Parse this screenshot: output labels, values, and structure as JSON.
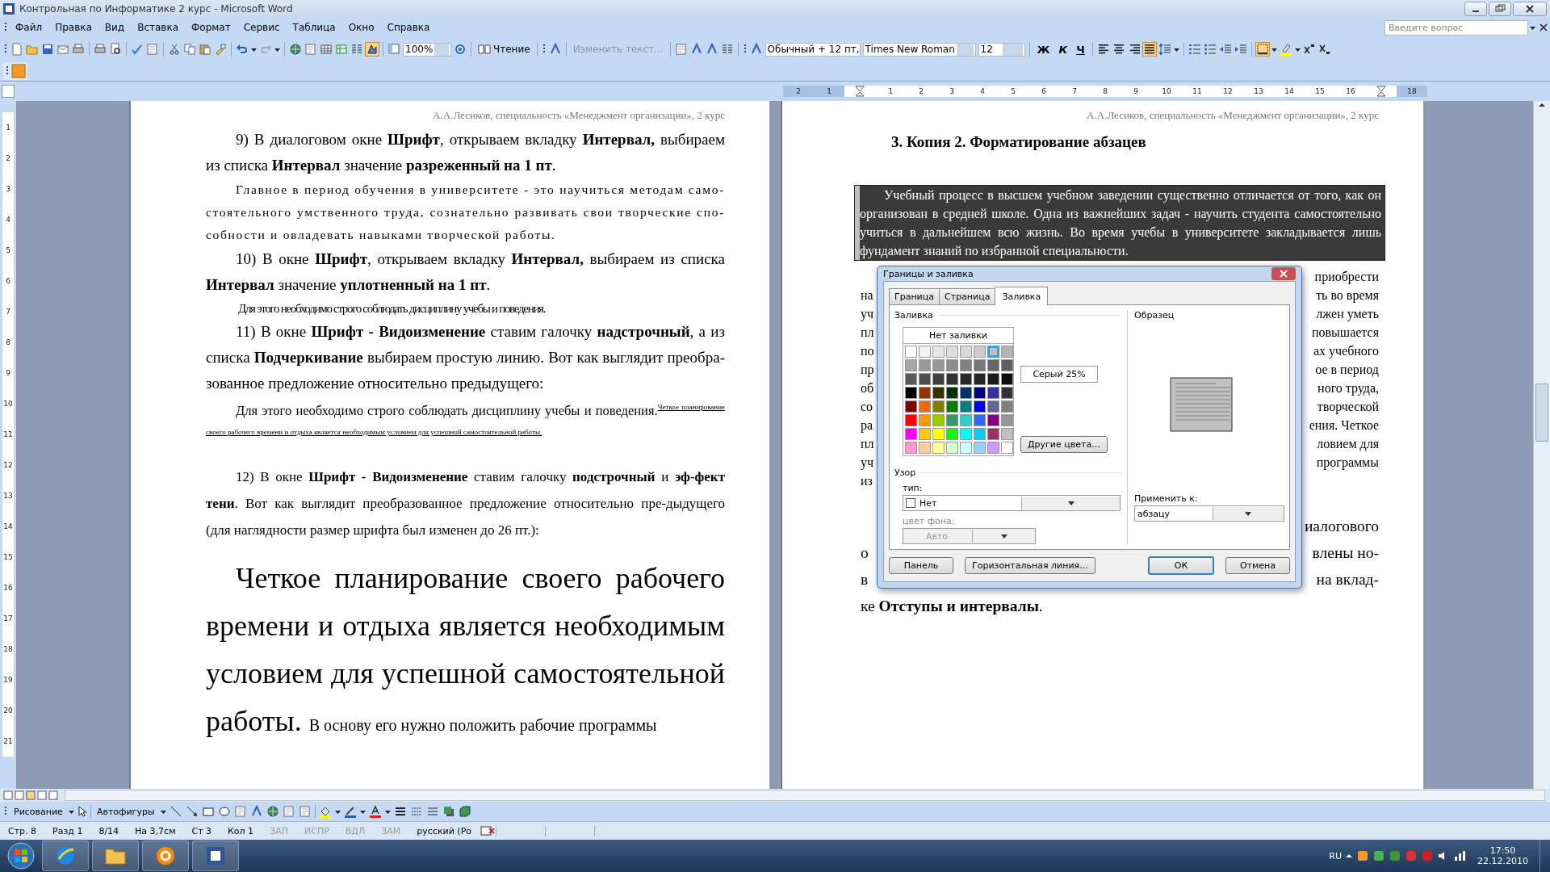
{
  "window": {
    "title": "Контрольная по Информатике  2 курс - Microsoft Word"
  },
  "menu": [
    {
      "label": "Файл"
    },
    {
      "label": "Правка"
    },
    {
      "label": "Вид"
    },
    {
      "label": "Вставка"
    },
    {
      "label": "Формат"
    },
    {
      "label": "Сервис"
    },
    {
      "label": "Таблица"
    },
    {
      "label": "Окно"
    },
    {
      "label": "Справка"
    }
  ],
  "help_field": {
    "placeholder": "Введите вопрос"
  },
  "standard_toolbar": {
    "zoom": "100%",
    "reading_button": "Чтение",
    "edit_text_button": "Изменить текст..."
  },
  "formatting_toolbar": {
    "style": "Обычный + 12 пт,",
    "font": "Times New Roman",
    "size": "12",
    "bold": "Ж",
    "italic": "К",
    "underline": "Ч",
    "alignments": [
      {
        "kind": "left",
        "selected": false
      },
      {
        "kind": "center",
        "selected": false
      },
      {
        "kind": "right",
        "selected": false
      },
      {
        "kind": "justify",
        "selected": true
      }
    ]
  },
  "horizontal_ruler": [
    {
      "label": "2",
      "margin": true
    },
    {
      "label": "1",
      "margin": true
    },
    {
      "label": "1",
      "margin": false
    },
    {
      "label": "2",
      "margin": false
    },
    {
      "label": "3",
      "margin": false
    },
    {
      "label": "4",
      "margin": false
    },
    {
      "label": "5",
      "margin": false
    },
    {
      "label": "6",
      "margin": false
    },
    {
      "label": "7",
      "margin": false
    },
    {
      "label": "8",
      "margin": false
    },
    {
      "label": "9",
      "margin": false
    },
    {
      "label": "10",
      "margin": false
    },
    {
      "label": "11",
      "margin": false
    },
    {
      "label": "12",
      "margin": false
    },
    {
      "label": "13",
      "margin": false
    },
    {
      "label": "14",
      "margin": false
    },
    {
      "label": "15",
      "margin": false
    },
    {
      "label": "16",
      "margin": false
    },
    {
      "label": "18",
      "margin": true
    }
  ],
  "vertical_ruler": [
    "1",
    "2",
    "3",
    "4",
    "5",
    "6",
    "7",
    "8",
    "9",
    "10",
    "11",
    "12",
    "13",
    "14",
    "15",
    "16",
    "17",
    "18",
    "19",
    "20",
    "21"
  ],
  "left_page": {
    "header": "А.А.Лесиков, специальность «Менеджмент организации», 2 курс",
    "paragraphs": [
      {
        "kind": "normal",
        "text": "9) В диалоговом окне **Шрифт**, открываем вкладку **Интервал,** выбираем из списка **Интервал** значение **разреженный на 1 пт**."
      },
      {
        "kind": "expanded",
        "text": "Главное в период обучения в университете - это научиться методам само-стоятельного умственного труда, сознательно развивать свои творческие спо-собности и овладевать навыками творческой работы."
      },
      {
        "kind": "normal",
        "text": "10) В  окне **Шрифт**, открываем вкладку **Интервал,** выбираем из списка **Интервал** значение **уплотненный на 1 пт**."
      },
      {
        "kind": "condensed",
        "text": "Для этого необходимо строго соблюдать дисциплину учебы и поведения."
      },
      {
        "kind": "normal",
        "text": "11) В окне  **Шрифт - Видоизменение** ставим галочку **надстрочный**, а из списка **Подчеркивание** выбираем простую линию. Вот как выглядит преобра-зованное предложение относительно предыдущего:"
      },
      {
        "kind": "superscript",
        "text": "Для этого необходимо строго соблюдать дисциплину учебы и поведения.$^{Четкое планирование своего рабочего времени и отдыха является необходимым условием для успешной самостоятельной работы.}$"
      },
      {
        "kind": "small",
        "text": "12)  В окне  **Шрифт - Видоизменение** ставим галочку **подстрочный** и **эф-фект тени**. Вот как выглядит преобразованное предложение относительно пре-дыдущего (для наглядности размер шрифта был изменен до 26 пт.):"
      },
      {
        "kind": "large",
        "text": "Четкое планирование своего рабочего времени и отдыха является необходимым условием для успешной самостоятельной работы.",
        "continuation": "В основу его нужно положить рабочие программы"
      }
    ]
  },
  "right_page": {
    "header": "А.А.Лесиков, специальность «Менеджмент организации», 2 курс",
    "heading": "3. Копия 2. Форматирование абзацев",
    "shaded_paragraph": "Учебный процесс в высшем учебном заведении существенно отличается от того, как он организован в средней школе. Одна из важнейших задач - научить студента самостоятельно учиться в дальнейшем всю жизнь. Во время учебы в университете закладывается лишь фундамент знаний по избранной специальности.",
    "partial_lines": [
      {
        "right": "приобрести"
      },
      {
        "left": "на",
        "right": "ть во время"
      },
      {
        "left": "уч",
        "right": "лжен уметь"
      },
      {
        "left": "пл",
        "right": "повышается"
      },
      {
        "left": "по",
        "right": "ах учебного"
      },
      {
        "left": "пр",
        "right": "ое в период"
      },
      {
        "left": "об",
        "right": "ного труда,"
      },
      {
        "left": "со",
        "right": "творческой"
      },
      {
        "left": "ра",
        "right": "ения. Четкое"
      },
      {
        "left": "пл",
        "right": "ловием для"
      },
      {
        "left": "уч",
        "right": "программы"
      },
      {
        "left": "из"
      }
    ],
    "partial_lines_large": [
      {
        "right": "иалогового"
      },
      {
        "left": "о",
        "right": "влены но-"
      },
      {
        "left": "в",
        "right": "на вклад-"
      }
    ],
    "closing": "ке **Отступы и интервалы**."
  },
  "dialog": {
    "title": "Границы и заливка",
    "tabs": [
      {
        "label": "Граница",
        "selected": false
      },
      {
        "label": "Страница",
        "selected": false
      },
      {
        "label": "Заливка",
        "selected": true
      }
    ],
    "fill_group": "Заливка",
    "no_fill_button": "Нет заливки",
    "colors": [
      {
        "color": "#ffffff",
        "selected": false
      },
      {
        "color": "#f2f2f2",
        "selected": false
      },
      {
        "color": "#e6e6e6",
        "selected": false
      },
      {
        "color": "#dddddd",
        "selected": false
      },
      {
        "color": "#d9d9d9",
        "selected": false
      },
      {
        "color": "#cccccc",
        "selected": false
      },
      {
        "color": "#c0c0c0",
        "selected": true
      },
      {
        "color": "#b2b2b2",
        "selected": false
      },
      {
        "color": "#a6a6a6",
        "selected": false
      },
      {
        "color": "#999999",
        "selected": false
      },
      {
        "color": "#969696",
        "selected": false
      },
      {
        "color": "#8c8c8c",
        "selected": false
      },
      {
        "color": "#808080",
        "selected": false
      },
      {
        "color": "#777777",
        "selected": false
      },
      {
        "color": "#666666",
        "selected": false
      },
      {
        "color": "#5f5f5f",
        "selected": false
      },
      {
        "color": "#595959",
        "selected": false
      },
      {
        "color": "#4d4d4d",
        "selected": false
      },
      {
        "color": "#404040",
        "selected": false
      },
      {
        "color": "#333333",
        "selected": false
      },
      {
        "color": "#292929",
        "selected": false
      },
      {
        "color": "#262626",
        "selected": false
      },
      {
        "color": "#1c1c1c",
        "selected": false
      },
      {
        "color": "#0d0d0d",
        "selected": false
      },
      {
        "color": "#000000",
        "selected": false
      },
      {
        "color": "#993300",
        "selected": false
      },
      {
        "color": "#333300",
        "selected": false
      },
      {
        "color": "#003300",
        "selected": false
      },
      {
        "color": "#003366",
        "selected": false
      },
      {
        "color": "#000080",
        "selected": false
      },
      {
        "color": "#333399",
        "selected": false
      },
      {
        "color": "#333333",
        "selected": false
      },
      {
        "color": "#800000",
        "selected": false
      },
      {
        "color": "#ff6600",
        "selected": false
      },
      {
        "color": "#808000",
        "selected": false
      },
      {
        "color": "#008000",
        "selected": false
      },
      {
        "color": "#008080",
        "selected": false
      },
      {
        "color": "#0000ff",
        "selected": false
      },
      {
        "color": "#666699",
        "selected": false
      },
      {
        "color": "#808080",
        "selected": false
      },
      {
        "color": "#ff0000",
        "selected": false
      },
      {
        "color": "#ff9900",
        "selected": false
      },
      {
        "color": "#99cc00",
        "selected": false
      },
      {
        "color": "#339966",
        "selected": false
      },
      {
        "color": "#33cccc",
        "selected": false
      },
      {
        "color": "#3366ff",
        "selected": false
      },
      {
        "color": "#800080",
        "selected": false
      },
      {
        "color": "#969696",
        "selected": false
      },
      {
        "color": "#ff00ff",
        "selected": false
      },
      {
        "color": "#ffcc00",
        "selected": false
      },
      {
        "color": "#ffff00",
        "selected": false
      },
      {
        "color": "#00ff00",
        "selected": false
      },
      {
        "color": "#00ffff",
        "selected": false
      },
      {
        "color": "#00ccff",
        "selected": false
      },
      {
        "color": "#993366",
        "selected": false
      },
      {
        "color": "#c0c0c0",
        "selected": false
      },
      {
        "color": "#ff99cc",
        "selected": false
      },
      {
        "color": "#ffcc99",
        "selected": false
      },
      {
        "color": "#ffff99",
        "selected": false
      },
      {
        "color": "#ccffcc",
        "selected": false
      },
      {
        "color": "#ccffff",
        "selected": false
      },
      {
        "color": "#99ccff",
        "selected": false
      },
      {
        "color": "#cc99ff",
        "selected": false
      },
      {
        "color": "#ffffff",
        "selected": false
      }
    ],
    "color_name": "Серый 25%",
    "more_colors_button": "Другие цвета...",
    "pattern_group": "Узор",
    "style_label": "тип:",
    "style_value": "Нет",
    "background_label": "цвет фона:",
    "background_value": "Авто",
    "background_disabled": true,
    "preview_group": "Образец",
    "apply_label": "Применить к:",
    "apply_value": "абзацу",
    "buttons": [
      {
        "label": "Панель",
        "default": false
      },
      {
        "label": "Горизонтальная линия...",
        "default": false
      },
      {
        "label": "ОК",
        "default": true
      },
      {
        "label": "Отмена",
        "default": false
      }
    ]
  },
  "drawing_toolbar": {
    "draw_menu": "Рисование",
    "autoshapes_menu": "Автофигуры"
  },
  "status_bar": [
    {
      "text": "Стр. 8",
      "disabled": false
    },
    {
      "text": "Разд 1",
      "disabled": false
    },
    {
      "text": "8/14",
      "disabled": false
    },
    {
      "text": "На 3,7см",
      "disabled": false
    },
    {
      "text": "Ст 3",
      "disabled": false
    },
    {
      "text": "Кол 1",
      "disabled": false
    },
    {
      "text": "ЗАП",
      "disabled": true
    },
    {
      "text": "ИСПР",
      "disabled": true
    },
    {
      "text": "ВДЛ",
      "disabled": true
    },
    {
      "text": "ЗАМ",
      "disabled": true
    },
    {
      "text": "русский (Ро",
      "disabled": false
    }
  ],
  "taskbar": {
    "language": "RU",
    "time": "17:50",
    "date": "22.12.2010"
  }
}
